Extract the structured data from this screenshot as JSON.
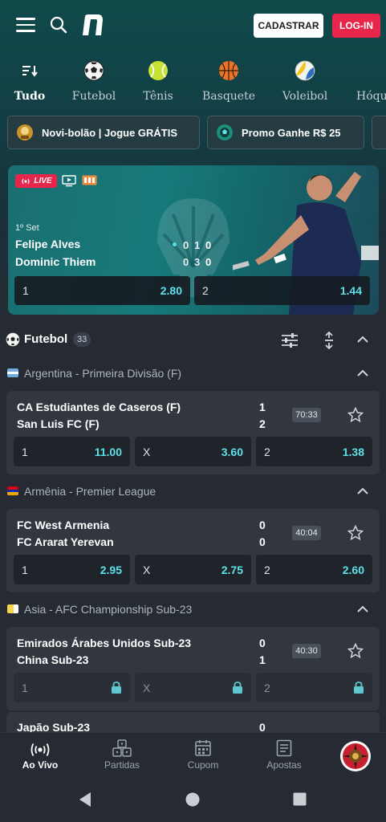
{
  "header": {
    "signup_label": "CADASTRAR",
    "login_label": "LOG-IN"
  },
  "sports_tabs": [
    {
      "label": "Tudo",
      "icon": "sort-icon",
      "active": true
    },
    {
      "label": "Futebol",
      "icon": "soccer-ball-icon"
    },
    {
      "label": "Tênis",
      "icon": "tennis-ball-icon"
    },
    {
      "label": "Basquete",
      "icon": "basketball-icon"
    },
    {
      "label": "Voleibol",
      "icon": "volleyball-icon"
    },
    {
      "label": "Hóqu",
      "icon": "hockey-icon"
    }
  ],
  "promos": [
    {
      "label": "Novi-bolão | Jogue GRÁTIS",
      "icon": "trophy-mascot-icon"
    },
    {
      "label": "Promo Ganhe R$ 25",
      "icon": "soccer-ball-icon"
    }
  ],
  "live_match": {
    "badge": "LIVE",
    "set_label": "1º Set",
    "player1": {
      "name": "Felipe Alves",
      "games": "0",
      "points": "1",
      "set": "0",
      "serving": true
    },
    "player2": {
      "name": "Dominic Thiem",
      "games": "0",
      "points": "3",
      "set": "0",
      "serving": false
    },
    "odds": [
      {
        "selection": "1",
        "value": "2.80"
      },
      {
        "selection": "2",
        "value": "1.44"
      }
    ]
  },
  "section": {
    "title": "Futebol",
    "count": "33"
  },
  "leagues": [
    {
      "name": "Argentina - Primeira Divisão (F)",
      "flag_colors": [
        "#74acdf",
        "#ffffff",
        "#74acdf"
      ],
      "match": {
        "home": "CA Estudiantes de Caseros (F)",
        "away": "San Luis FC (F)",
        "home_score": "1",
        "away_score": "2",
        "time": "70:33",
        "odds": [
          {
            "selection": "1",
            "value": "11.00"
          },
          {
            "selection": "X",
            "value": "3.60"
          },
          {
            "selection": "2",
            "value": "1.38"
          }
        ]
      }
    },
    {
      "name": "Armênia - Premier League",
      "flag_colors": [
        "#d90012",
        "#0033a0",
        "#f2a800"
      ],
      "match": {
        "home": "FC West Armenia",
        "away": "FC Ararat Yerevan",
        "home_score": "0",
        "away_score": "0",
        "time": "40:04",
        "odds": [
          {
            "selection": "1",
            "value": "2.95"
          },
          {
            "selection": "X",
            "value": "2.75"
          },
          {
            "selection": "2",
            "value": "2.60"
          }
        ]
      }
    },
    {
      "name": "Asia - AFC Championship Sub-23",
      "flag_colors": [
        "#f5d64a",
        "#ffffff",
        "#f5d64a"
      ],
      "match": {
        "home": "Emirados Árabes Unidos Sub-23",
        "away": "China Sub-23",
        "home_score": "0",
        "away_score": "1",
        "time": "40:30",
        "locked": true,
        "odds": [
          {
            "selection": "1",
            "value": ""
          },
          {
            "selection": "X",
            "value": ""
          },
          {
            "selection": "2",
            "value": ""
          }
        ]
      }
    }
  ],
  "partial_match": {
    "home": "Japão Sub-23",
    "home_score": "0"
  },
  "bottom_nav": [
    {
      "label": "Ao Vivo",
      "icon": "live-broadcast-icon",
      "active": true
    },
    {
      "label": "Partidas",
      "icon": "dice-icon"
    },
    {
      "label": "Cupom",
      "icon": "calendar-coupon-icon"
    },
    {
      "label": "Apostas",
      "icon": "list-bets-icon"
    }
  ],
  "colors": {
    "accent_odds": "#5ee0ea",
    "login_red": "#e8254a",
    "card_bg": "#31363f",
    "page_bg": "#262b33"
  }
}
